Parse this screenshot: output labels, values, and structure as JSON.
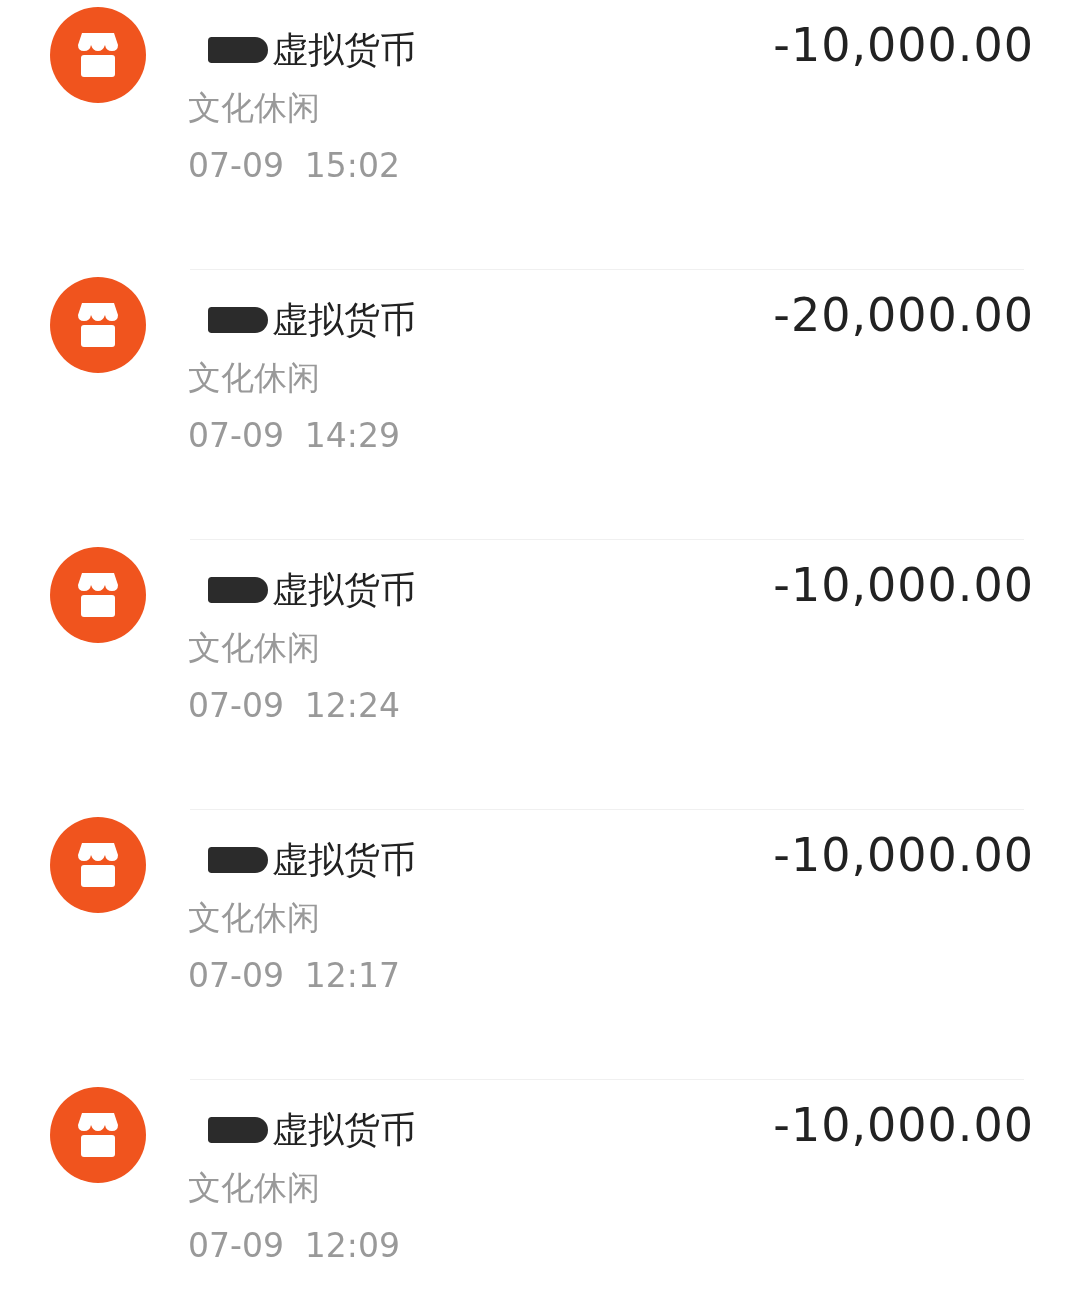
{
  "transactions": [
    {
      "title": "虚拟货币",
      "category": "文化休闲",
      "time": "07-09  15:02",
      "amount": "-10,000.00"
    },
    {
      "title": "虚拟货币",
      "category": "文化休闲",
      "time": "07-09  14:29",
      "amount": "-20,000.00"
    },
    {
      "title": "虚拟货币",
      "category": "文化休闲",
      "time": "07-09  12:24",
      "amount": "-10,000.00"
    },
    {
      "title": "虚拟货币",
      "category": "文化休闲",
      "time": "07-09  12:17",
      "amount": "-10,000.00"
    },
    {
      "title": "虚拟货币",
      "category": "文化休闲",
      "time": "07-09  12:09",
      "amount": "-10,000.00"
    }
  ]
}
